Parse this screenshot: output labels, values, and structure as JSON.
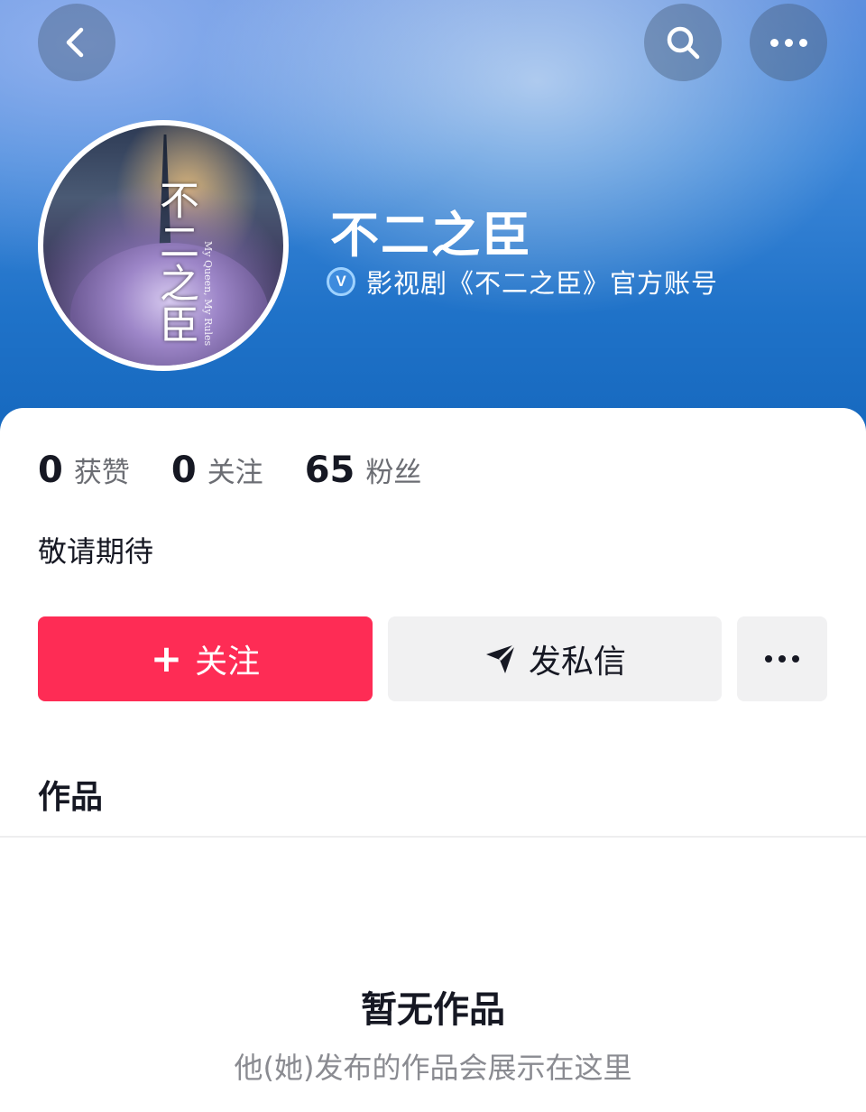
{
  "profile": {
    "name": "不二之臣",
    "verified_text": "影视剧《不二之臣》官方账号",
    "verify_badge": "V",
    "avatar_title": "不二之臣",
    "avatar_subtitle": "My Queen, My Rules",
    "bio": "敬请期待"
  },
  "stats": [
    {
      "value": "0",
      "label": "获赞"
    },
    {
      "value": "0",
      "label": "关注"
    },
    {
      "value": "65",
      "label": "粉丝"
    }
  ],
  "actions": {
    "follow_plus": "+",
    "follow_label": "关注",
    "message_label": "发私信"
  },
  "tabs": {
    "works_label": "作品"
  },
  "empty_state": {
    "title": "暂无作品",
    "subtitle": "他(她)发布的作品会展示在这里"
  },
  "icons": {
    "back": "chevron-left-icon",
    "search": "search-icon",
    "more": "more-horizontal-icon",
    "verify": "verified-badge-icon",
    "send": "send-icon"
  },
  "colors": {
    "accent": "#fe2c55",
    "header_blue": "#1f72c8",
    "secondary_button": "#f1f1f2",
    "primary_text": "#161823",
    "muted_text": "#8a8b91"
  }
}
